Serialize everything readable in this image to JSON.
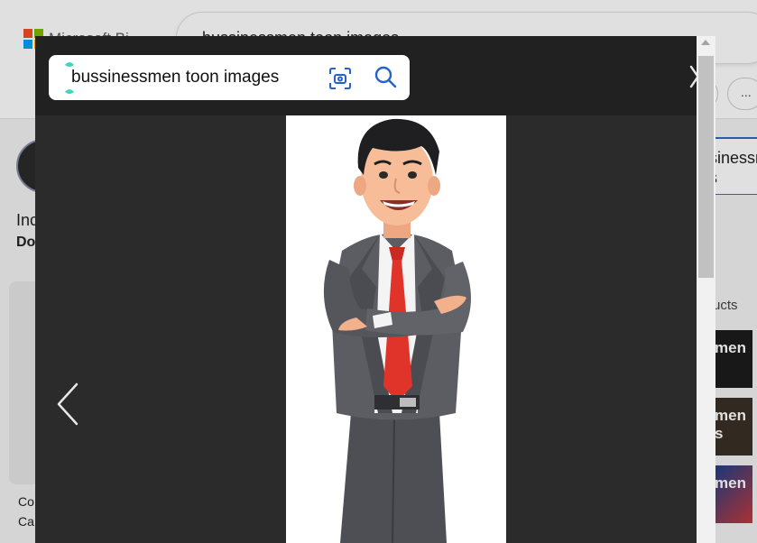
{
  "background": {
    "logo_text": "Microsoft Bi",
    "search_query": "bussinessmen toon images",
    "more_button": "...",
    "left_heading": "Inc",
    "left_subheading": "Do",
    "left_caption_1": "Co",
    "left_caption_2": "Ca",
    "side_card_line1": "sinessm",
    "side_card_line2": "s",
    "products_label": "ucts",
    "tiles": [
      "men",
      "men",
      "men"
    ],
    "tile_sub": "s"
  },
  "viewer": {
    "search_query": "bussinessmen toon images",
    "icons": {
      "copilot": "copilot-icon",
      "visual_search": "visual-search-icon",
      "search": "search-icon",
      "previous": "chevron-left-icon",
      "close": "close-icon"
    },
    "image_subject": "cartoon businessman in grey suit with red tie, arms crossed"
  },
  "colors": {
    "modal_bg": "#2b2b2b",
    "topbar_bg": "#212121",
    "accent_blue": "#2a6ac0",
    "tie_red": "#e0342a",
    "suit_grey": "#5a5a60"
  }
}
